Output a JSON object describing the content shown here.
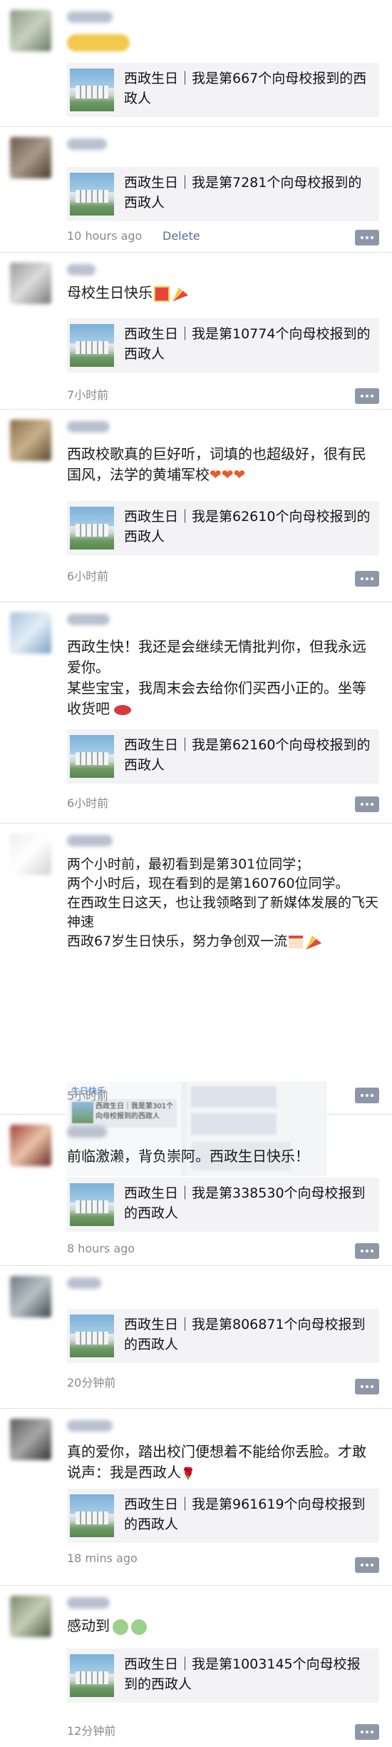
{
  "shared_card_prefix": "西政生日｜我是第",
  "posts": [
    {
      "text": "",
      "card": "西政生日｜我是第667个向母校报到的西政人",
      "time": ""
    },
    {
      "text": "",
      "card": "西政生日｜我是第7281个向母校报到的西政人",
      "time": "10 hours ago",
      "delete": "Delete"
    },
    {
      "text": "母校生日快乐",
      "card": "西政生日｜我是第10774个向母校报到的西政人",
      "time": "7小时前"
    },
    {
      "text": "西政校歌真的巨好听，词填的也超级好，很有民国风，法学的黄埔军校",
      "card": "西政生日｜我是第62610个向母校报到的西政人",
      "time": "6小时前"
    },
    {
      "text": "西政生快！我还是会继续无情批判你，但我永远爱你。\n某些宝宝，我周末会去给你们买西小正的。坐等收货吧",
      "card": "西政生日｜我是第62160个向母校报到的西政人",
      "time": "6小时前"
    },
    {
      "text": "两个小时前，最初看到是第301位同学；\n两个小时后，现在看到的是第160760位同学。\n在西政生日这天，也让我领略到了新媒体发展的飞天神速\n西政67岁生日快乐，努力争创双一流",
      "shot_caption": "生日快乐",
      "shot_card": "西政生日｜我是第301个向母校报到的西政人",
      "time": "5小时前"
    },
    {
      "text": "前临激濑，背负崇阿。西政生日快乐！",
      "card": "西政生日｜我是第338530个向母校报到的西政人",
      "time": "8 hours ago"
    },
    {
      "text": "",
      "card": "西政生日｜我是第806871个向母校报到的西政人",
      "time": "20分钟前"
    },
    {
      "text": "真的爱你，踏出校门便想着不能给你丢脸。才敢说声：我是西政人",
      "card": "西政生日｜我是第961619个向母校报到的西政人",
      "time": "18 mins ago"
    },
    {
      "text": "感动到",
      "card": "西政生日｜我是第1003145个向母校报到的西政人",
      "time": "12分钟前"
    }
  ],
  "colors": {
    "link": "#576b95",
    "meta": "#8a8a8a",
    "card_bg": "#f3f3f5",
    "more_button": "#8e97a8"
  },
  "icons": [
    "gift-emoji",
    "party-popper-emoji",
    "heart-emoji",
    "lips-emoji",
    "thumbs-up-emoji",
    "cake-emoji",
    "rose-emoji",
    "crying-face-emoji"
  ]
}
